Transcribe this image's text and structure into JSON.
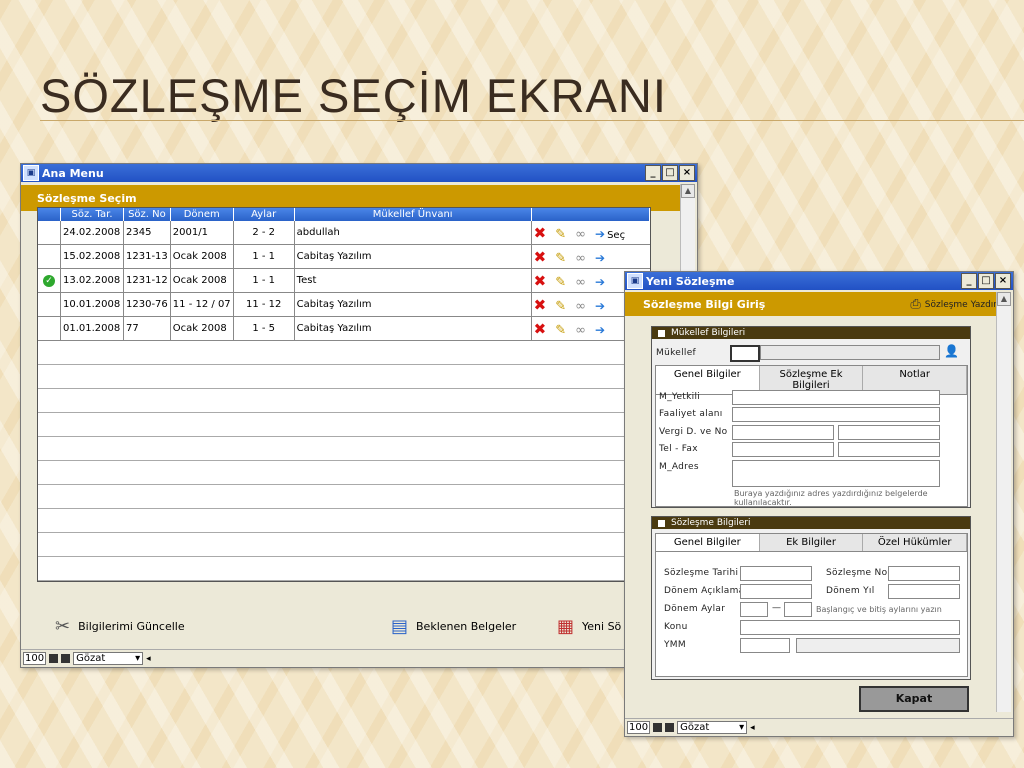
{
  "slide": {
    "title": "SÖZLEŞME SEÇİM EKRANI"
  },
  "main_window": {
    "title": "Ana Menu",
    "header": "Sözleşme Seçim",
    "columns": [
      "Söz. Tar.",
      "Söz. No",
      "Dönem",
      "Aylar",
      "Mükellef Ünvanı"
    ],
    "rows": [
      {
        "date": "24.02.2008",
        "no": "2345",
        "period": "2001/1",
        "months": "2 - 2",
        "name": "abdullah",
        "checked": false,
        "select_label": "Seç"
      },
      {
        "date": "15.02.2008",
        "no": "1231-13",
        "period": "Ocak 2008",
        "months": "1 - 1",
        "name": "Cabitaş Yazılım",
        "checked": false
      },
      {
        "date": "13.02.2008",
        "no": "1231-12",
        "period": "Ocak 2008",
        "months": "1 - 1",
        "name": "Test",
        "checked": true
      },
      {
        "date": "10.01.2008",
        "no": "1230-76",
        "period": "11 - 12 / 07",
        "months": "11 - 12",
        "name": "Cabitaş Yazılım",
        "checked": false
      },
      {
        "date": "01.01.2008",
        "no": "77",
        "period": "Ocak 2008",
        "months": "1 - 5",
        "name": "Cabitaş Yazılım",
        "checked": false
      }
    ],
    "tools": {
      "update": "Bilgilerimi Güncelle",
      "pending": "Beklenen Belgeler",
      "new": "Yeni Sö"
    },
    "status": {
      "zoom": "100",
      "view": "Gözat"
    }
  },
  "new_window": {
    "title": "Yeni Sözleşme",
    "header": "Sözleşme Bilgi Giriş",
    "print_label": "Sözleşme Yazdır",
    "taxpayer_panel": {
      "title": "Mükellef Bilgileri",
      "label": "Mükellef",
      "tabs": [
        "Genel Bilgiler",
        "Sözleşme Ek Bilgileri",
        "Notlar"
      ],
      "fields": [
        "M_Yetkili",
        "Faaliyet alanı",
        "Vergi D. ve No",
        "Tel - Fax",
        "M_Adres"
      ],
      "note": "Buraya yazdığınız adres yazdırdığınız belgelerde kullanılacaktır."
    },
    "contract_panel": {
      "title": "Sözleşme Bilgileri",
      "tabs": [
        "Genel Bilgiler",
        "Ek Bilgiler",
        "Özel Hükümler"
      ],
      "labels": {
        "date": "Sözleşme Tarihi",
        "no": "Sözleşme No",
        "period_desc": "Dönem Açıklama",
        "period_year": "Dönem Yıl",
        "period_months": "Dönem Aylar",
        "months_hint": "Başlangıç ve bitiş aylarını yazın",
        "subject": "Konu",
        "ymm": "YMM"
      },
      "dash": "—"
    },
    "close_button": "Kapat",
    "status": {
      "zoom": "100",
      "view": "Gözat"
    }
  }
}
